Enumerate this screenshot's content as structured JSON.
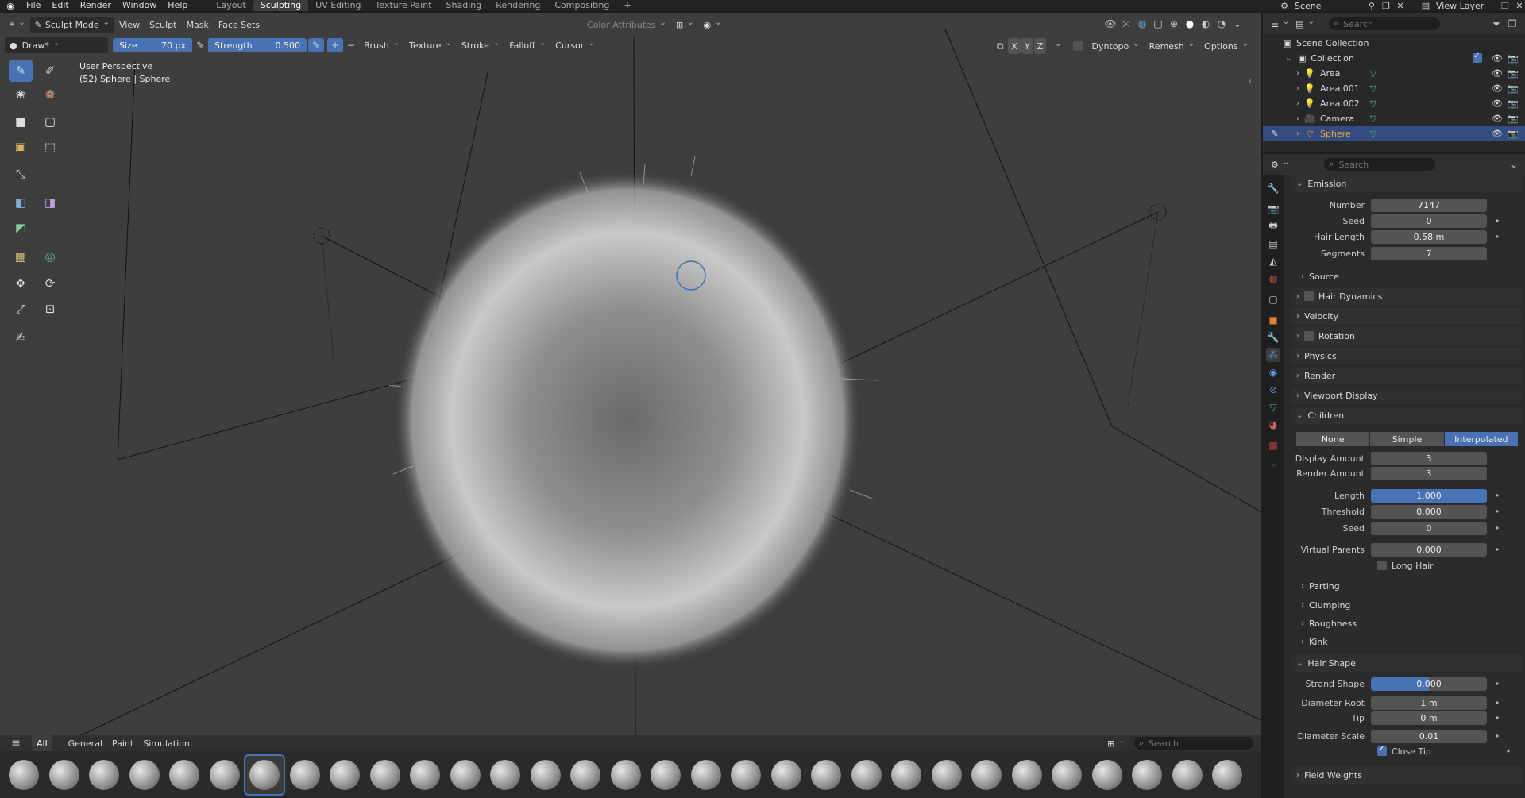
{
  "topbar": {
    "menus": [
      "File",
      "Edit",
      "Render",
      "Window",
      "Help"
    ],
    "workspaces": [
      "Layout",
      "Sculpting",
      "UV Editing",
      "Texture Paint",
      "Shading",
      "Rendering",
      "Compositing"
    ],
    "active_workspace": "Sculpting",
    "scene": "Scene",
    "view_layer": "View Layer"
  },
  "viewport_header": {
    "mode": "Sculpt Mode",
    "menus": [
      "View",
      "Sculpt",
      "Mask",
      "Face Sets"
    ],
    "color_attributes": "Color Attributes"
  },
  "tool_settings": {
    "brush": "Draw*",
    "size_label": "Size",
    "size_value": "70 px",
    "strength_label": "Strength",
    "strength_value": "0.500",
    "menus": [
      "Brush",
      "Texture",
      "Stroke",
      "Falloff",
      "Cursor"
    ],
    "axes": [
      "X",
      "Y",
      "Z"
    ],
    "dyntopo": "Dyntopo",
    "remesh": "Remesh",
    "options": "Options"
  },
  "viewport_overlay": {
    "perspective": "User Perspective",
    "object_info": "(52) Sphere | Sphere"
  },
  "asset_shelf": {
    "tabs": [
      "All",
      "General",
      "Paint",
      "Simulation"
    ],
    "active_tab": "All",
    "search_placeholder": "Search"
  },
  "outliner": {
    "search_placeholder": "Search",
    "scene_collection": "Scene Collection",
    "collection": "Collection",
    "items": [
      "Area",
      "Area.001",
      "Area.002",
      "Camera",
      "Sphere"
    ],
    "selected": "Sphere"
  },
  "properties": {
    "search_placeholder": "Search",
    "emission": {
      "title": "Emission",
      "number_label": "Number",
      "number": "7147",
      "seed_label": "Seed",
      "seed": "0",
      "hair_length_label": "Hair Length",
      "hair_length": "0.58 m",
      "segments_label": "Segments",
      "segments": "7",
      "source": "Source"
    },
    "collapsed_panels": [
      "Hair Dynamics",
      "Velocity",
      "Rotation",
      "Physics",
      "Render",
      "Viewport Display"
    ],
    "children": {
      "title": "Children",
      "modes": [
        "None",
        "Simple",
        "Interpolated"
      ],
      "active_mode": "Interpolated",
      "display_amount_label": "Display Amount",
      "display_amount": "3",
      "render_amount_label": "Render Amount",
      "render_amount": "3",
      "length_label": "Length",
      "length": "1.000",
      "threshold_label": "Threshold",
      "threshold": "0.000",
      "seed_label": "Seed",
      "seed": "0",
      "virtual_parents_label": "Virtual Parents",
      "virtual_parents": "0.000",
      "long_hair": "Long Hair",
      "subpanels": [
        "Parting",
        "Clumping",
        "Roughness",
        "Kink"
      ]
    },
    "hair_shape": {
      "title": "Hair Shape",
      "strand_shape_label": "Strand Shape",
      "strand_shape": "0.000",
      "diameter_root_label": "Diameter Root",
      "diameter_root": "1 m",
      "tip_label": "Tip",
      "tip": "0 m",
      "diameter_scale_label": "Diameter Scale",
      "diameter_scale": "0.01",
      "close_tip": "Close Tip"
    },
    "field_weights": "Field Weights"
  }
}
